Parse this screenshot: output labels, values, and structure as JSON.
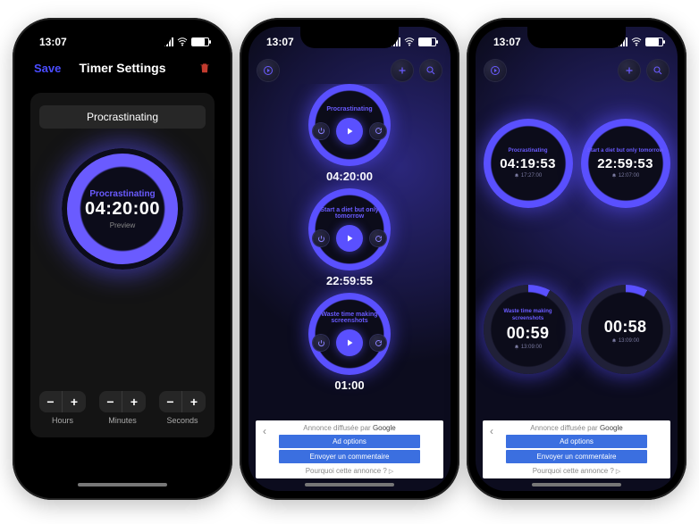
{
  "status": {
    "time": "13:07"
  },
  "colors": {
    "accent": "#5a50ff",
    "save": "#4a4cff",
    "trash": "#c23b2e"
  },
  "screen1": {
    "nav": {
      "save": "Save",
      "title": "Timer Settings"
    },
    "name_value": "Procrastinating",
    "preview": {
      "title": "Procrastinating",
      "time": "04:20:00",
      "sub": "Preview"
    },
    "steppers": {
      "hours": {
        "minus": "−",
        "plus": "+",
        "label": "Hours"
      },
      "minutes": {
        "minus": "−",
        "plus": "+",
        "label": "Minutes"
      },
      "seconds": {
        "minus": "−",
        "plus": "+",
        "label": "Seconds"
      }
    }
  },
  "screen2": {
    "timers": [
      {
        "title": "Procrastinating",
        "time": "04:20:00"
      },
      {
        "title": "Start a diet but only tomorrow",
        "time": "22:59:55"
      },
      {
        "title": "Waste time making screenshots",
        "time": "01:00"
      }
    ]
  },
  "screen3": {
    "timers": [
      {
        "title": "Procrastinating",
        "time": "04:19:53",
        "bell": "17:27:00"
      },
      {
        "title": "Start a diet but only tomorrow",
        "time": "22:59:53",
        "bell": "12:07:00"
      },
      {
        "title": "Waste time making screenshots",
        "time": "00:59",
        "bell": "13:09:00"
      },
      {
        "title": "",
        "time": "00:58",
        "bell": "13:09:00"
      }
    ]
  },
  "ad": {
    "header_prefix": "Annonce diffusée par ",
    "header_brand": "Google",
    "row1": "Ad options",
    "row2": "Envoyer un commentaire",
    "why": "Pourquoi cette annonce ?"
  },
  "icons": {
    "play": "play-icon",
    "power": "power-icon",
    "reload": "reload-icon",
    "add": "plus-icon",
    "zoom": "magnifier-icon",
    "bell": "bell-icon",
    "trash": "trash-icon"
  }
}
